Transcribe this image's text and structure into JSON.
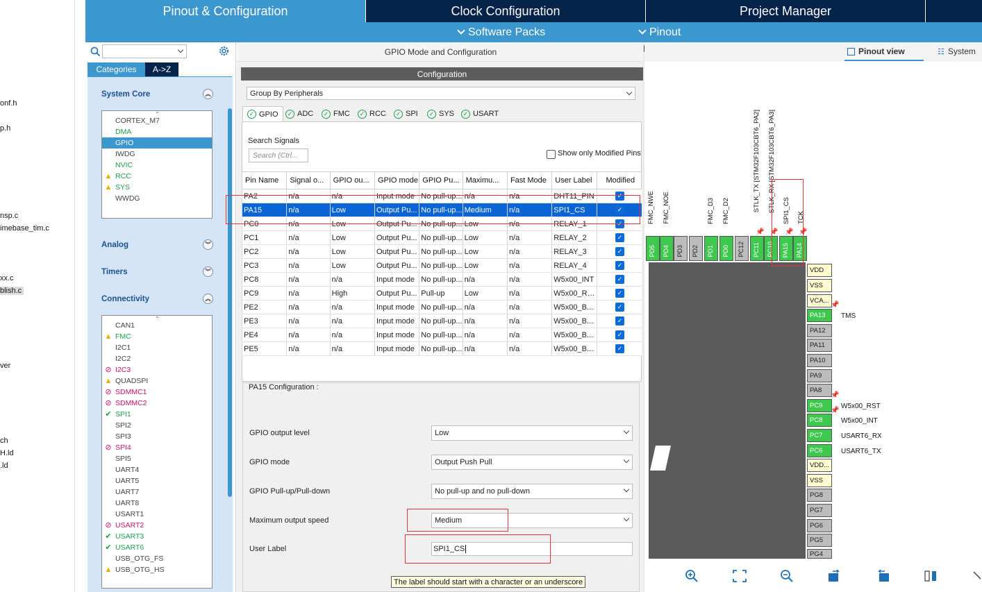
{
  "filetree": [
    "onf.h",
    "p.h",
    "nsp.c",
    "imebase_tim.c",
    "xx.c",
    "blish.c",
    "ver",
    "ch",
    "H.ld",
    ".ld"
  ],
  "tabs": {
    "pinout": "Pinout & Configuration",
    "clock": "Clock Configuration",
    "project": "Project Manager"
  },
  "subbar": {
    "software_packs": "Software Packs",
    "pinout": "Pinout"
  },
  "categories": {
    "tab_categories": "Categories",
    "tab_az": "A->Z",
    "system_core": {
      "title": "System Core",
      "items": [
        "CORTEX_M7",
        "DMA",
        "GPIO",
        "IWDG",
        "NVIC",
        "RCC",
        "SYS",
        "WWDG"
      ]
    },
    "analog": "Analog",
    "timers": "Timers",
    "connectivity": {
      "title": "Connectivity",
      "items": [
        "CAN1",
        "FMC",
        "I2C1",
        "I2C2",
        "I2C3",
        "QUADSPI",
        "SDMMC1",
        "SDMMC2",
        "SPI1",
        "SPI2",
        "SPI3",
        "SPI4",
        "SPI5",
        "UART4",
        "UART5",
        "UART7",
        "UART8",
        "USART1",
        "USART2",
        "USART3",
        "USART6",
        "USB_OTG_FS",
        "USB_OTG_HS"
      ]
    }
  },
  "gpio": {
    "title": "GPIO Mode and Configuration",
    "configuration": "Configuration",
    "group_by": "Group By Peripherals",
    "peripheral_tabs": [
      "GPIO",
      "ADC",
      "FMC",
      "RCC",
      "SPI",
      "SYS",
      "USART"
    ],
    "search_signals_label": "Search Signals",
    "search_placeholder": "Search (Ctrl...",
    "show_modified": "Show only Modified Pins",
    "columns": [
      "Pin Name",
      "Signal o...",
      "GPIO ou...",
      "GPIO mode",
      "GPIO Pu...",
      "Maximu...",
      "Fast Mode",
      "User Label",
      "Modified"
    ],
    "rows": [
      [
        "PA2",
        "n/a",
        "n/a",
        "Input mode",
        "No pull-up...",
        "n/a",
        "n/a",
        "DHT11_PIN"
      ],
      [
        "PA15",
        "n/a",
        "Low",
        "Output Pu...",
        "No pull-up...",
        "Medium",
        "n/a",
        "SPI1_CS"
      ],
      [
        "PC0",
        "n/a",
        "Low",
        "Output Pu...",
        "No pull-up...",
        "Low",
        "n/a",
        "RELAY_1"
      ],
      [
        "PC1",
        "n/a",
        "Low",
        "Output Pu...",
        "No pull-up...",
        "Low",
        "n/a",
        "RELAY_2"
      ],
      [
        "PC2",
        "n/a",
        "Low",
        "Output Pu...",
        "No pull-up...",
        "Low",
        "n/a",
        "RELAY_3"
      ],
      [
        "PC3",
        "n/a",
        "Low",
        "Output Pu...",
        "No pull-up...",
        "Low",
        "n/a",
        "RELAY_4"
      ],
      [
        "PC8",
        "n/a",
        "n/a",
        "Input mode",
        "No pull-up...",
        "n/a",
        "n/a",
        "W5x00_INT"
      ],
      [
        "PC9",
        "n/a",
        "High",
        "Output Pu...",
        "Pull-up",
        "Low",
        "n/a",
        "W5x00_RST"
      ],
      [
        "PE2",
        "n/a",
        "n/a",
        "Input mode",
        "No pull-up...",
        "n/a",
        "n/a",
        "W5x00_B..."
      ],
      [
        "PE3",
        "n/a",
        "n/a",
        "Input mode",
        "No pull-up...",
        "n/a",
        "n/a",
        "W5x00_B..."
      ],
      [
        "PE4",
        "n/a",
        "n/a",
        "Input mode",
        "No pull-up...",
        "n/a",
        "n/a",
        "W5x00_B..."
      ],
      [
        "PE5",
        "n/a",
        "n/a",
        "Input mode",
        "No pull-up...",
        "n/a",
        "n/a",
        "W5x00_B..."
      ]
    ],
    "pin_config_title": "PA15 Configuration :",
    "fields": {
      "output_level": {
        "label": "GPIO output level",
        "value": "Low"
      },
      "mode": {
        "label": "GPIO mode",
        "value": "Output Push Pull"
      },
      "pull": {
        "label": "GPIO Pull-up/Pull-down",
        "value": "No pull-up and no pull-down"
      },
      "speed": {
        "label": "Maximum output speed",
        "value": "Medium"
      },
      "user_label": {
        "label": "User Label",
        "value": "SPI1_CS"
      }
    },
    "tooltip": "The label should start with a character or an underscore"
  },
  "pinout": {
    "pinout_view": "Pinout view",
    "system_view": "System",
    "top_pins": [
      "PD5",
      "PD4",
      "PD3",
      "PD2",
      "PD1",
      "PD0",
      "PC12",
      "PC11",
      "PC10",
      "PA15",
      "PA14"
    ],
    "top_labels": [
      "FMC_NWE",
      "FMC_NOE",
      "FMC_D3",
      "FMC_D2",
      "STLK_TX [STM32F103CBT6_PA2]",
      "STLK_RX [STM32F103CBT6_PA3]",
      "SPI1_CS",
      "TCK"
    ],
    "right_pins": [
      "VDD",
      "VSS",
      "VCA...",
      "PA13",
      "PA12",
      "PA11",
      "PA10",
      "PA9",
      "PA8",
      "PC9",
      "PC8",
      "PC7",
      "PC6",
      "VDD...",
      "VSS",
      "PG8",
      "PG7",
      "PG6",
      "PG5",
      "PG4"
    ],
    "right_labels": [
      "TMS",
      "W5x00_RST",
      "W5x00_INT",
      "USART6_RX",
      "USART6_TX"
    ]
  }
}
